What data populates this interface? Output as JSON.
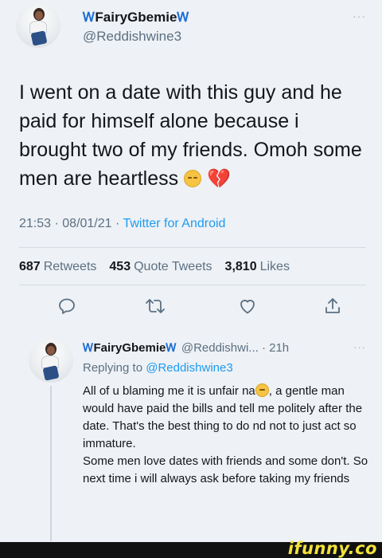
{
  "main_tweet": {
    "display_name": "FairyGbemie",
    "badge_left": "Ꮃ",
    "badge_right": "Ꮃ",
    "handle": "@Reddishwine3",
    "more": "···",
    "text_part1": "I went on a date with this guy and he paid for himself alone because i brought two of my friends. Omoh some men are heartless ",
    "emoji_1": "pensive-face",
    "emoji_2": "💔",
    "time": "21:53",
    "date": "08/01/21",
    "source": "Twitter for Android",
    "sep": " · "
  },
  "stats": {
    "retweets_count": "687",
    "retweets_label": "Retweets",
    "quotes_count": "453",
    "quotes_label": "Quote Tweets",
    "likes_count": "3,810",
    "likes_label": "Likes"
  },
  "actions": {
    "reply_icon": "reply-icon",
    "retweet_icon": "retweet-icon",
    "like_icon": "heart-icon",
    "share_icon": "share-icon"
  },
  "reply_tweet": {
    "display_name": "FairyGbemie",
    "badge_left": "Ꮃ",
    "badge_right": "Ꮃ",
    "meta": "@Reddishwi... · 21h",
    "more": "···",
    "replying_prefix": "Replying to ",
    "replying_handle": "@Reddishwine3",
    "text_part1": "All of u blaming me it is unfair na",
    "text_part2": ", a gentle man would have paid the bills and tell me politely after the date. That's the best thing to do nd not to just act so immature.\nSome men love dates with friends and some don't. So next time i will always ask before taking my friends"
  },
  "watermark": {
    "text": "ifunny.co"
  },
  "colors": {
    "background": "#eef1f5",
    "link": "#1d9bf0",
    "secondary": "#5b7083",
    "badge": "#1f6fd6",
    "ifunny_yellow": "#f3e23b"
  }
}
